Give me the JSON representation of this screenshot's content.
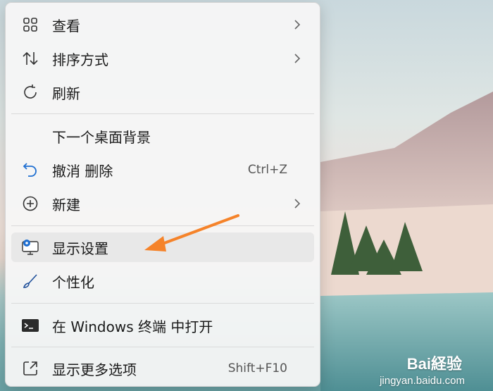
{
  "menu": {
    "items": [
      {
        "label": "查看",
        "icon": "grid-view-icon",
        "has_submenu": true
      },
      {
        "label": "排序方式",
        "icon": "sort-icon",
        "has_submenu": true
      },
      {
        "label": "刷新",
        "icon": "refresh-icon",
        "has_submenu": false
      },
      {
        "label": "下一个桌面背景",
        "icon": "",
        "has_submenu": false
      },
      {
        "label": "撤消 删除",
        "icon": "undo-icon",
        "shortcut": "Ctrl+Z"
      },
      {
        "label": "新建",
        "icon": "new-plus-icon",
        "has_submenu": true
      },
      {
        "label": "显示设置",
        "icon": "display-settings-icon",
        "highlighted": true
      },
      {
        "label": "个性化",
        "icon": "personalize-brush-icon"
      },
      {
        "label": "在 Windows 终端 中打开",
        "icon": "terminal-icon"
      },
      {
        "label": "显示更多选项",
        "icon": "more-options-icon",
        "shortcut": "Shift+F10"
      }
    ]
  },
  "annotation": {
    "color": "#f5832a",
    "target": "显示设置"
  },
  "watermark": {
    "brand": "Bai経验",
    "url": "jingyan.baidu.com"
  }
}
